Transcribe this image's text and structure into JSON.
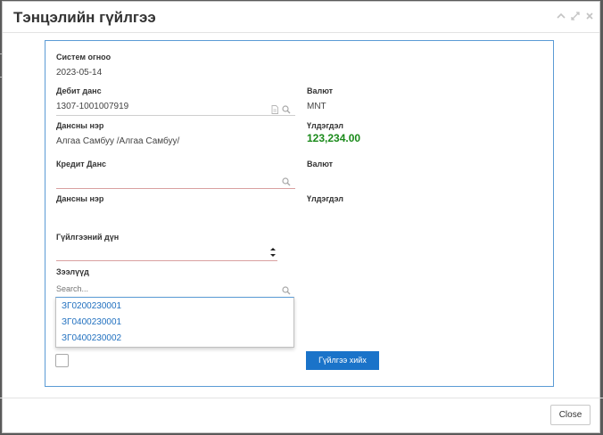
{
  "modal": {
    "title": "Тэнцэлийн гүйлгээ",
    "close_label": "Close"
  },
  "form": {
    "system_date_label": "Систем огноо",
    "system_date_value": "2023-05-14",
    "debit_account_label": "Дебит данс",
    "debit_account_value": "1307-1001007919",
    "debit_currency_label": "Валют",
    "debit_currency_value": "MNT",
    "debit_name_label": "Дансны нэр",
    "debit_name_value": "Алгаа Самбуу /Алгаа Самбуу/",
    "debit_balance_label": "Үлдэгдэл",
    "debit_balance_value": "123,234.00",
    "credit_account_label": "Кредит Данс",
    "credit_currency_label": "Валют",
    "credit_name_label": "Дансны нэр",
    "credit_balance_label": "Үлдэгдэл",
    "amount_label": "Гүйлгээний дүн",
    "loans_label": "Зээлүүд",
    "loans_search_placeholder": "Search...",
    "loan_options": [
      "ЗГ0200230001",
      "ЗГ0400230001",
      "ЗГ0400230002"
    ],
    "submit_label": "Гүйлгээ хийх"
  },
  "colors": {
    "accent": "#1a73c9",
    "balance": "#1a8a1a",
    "panel_border": "#5b9bd5"
  }
}
